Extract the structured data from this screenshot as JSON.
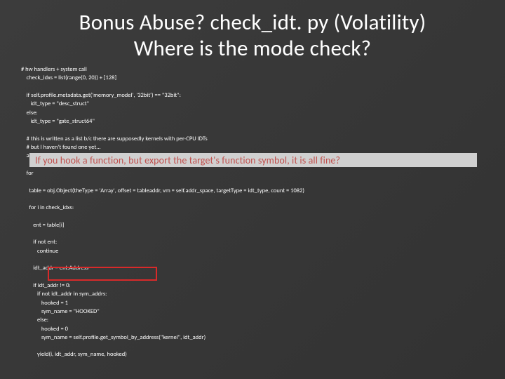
{
  "title_line1": "Bonus Abuse? check_idt. py (Volatility)",
  "title_line2": "Where is the mode check?",
  "code": "# hw handlers + system call\n    check_idxs = list(range(0, 20)) + [128]\n\n    if self.profile.metadata.get('memory_model', '32bit') == \"32bit\":\n       idt_type = \"desc_struct\"\n    else:\n       idt_type = \"gate_struct64\"\n\n    # this is written as a list b/c there are supposedly kernels with per-CPU IDTs\n    # but I haven't found one yet...\n    addrs = [self.addr_space.profile.get_symbol(\"idt_table\")]\n\n    for\n\n      table = obj.Object(theType = 'Array', offset = tableaddr, vm = self.addr_space, targetType = idt_type, count = 1082)\n\n      for i in check_idxs:\n\n         ent = table[i]\n\n         if not ent:\n            continue\n\n         idt_addr = ent.Address\n\n         if idt_addr != 0:\n            if not idt_addr in sym_addrs:\n               hooked = 1\n               sym_name = \"HOOKED\"\n            else:\n               hooked = 0\n               sym_name = self.profile.get_symbol_by_address(\"kernel\", idt_addr)\n\n            yield(i, idt_addr, sym_name, hooked)",
  "callout_text": "If you hook a function, but export the target's function symbol, it is all fine?"
}
